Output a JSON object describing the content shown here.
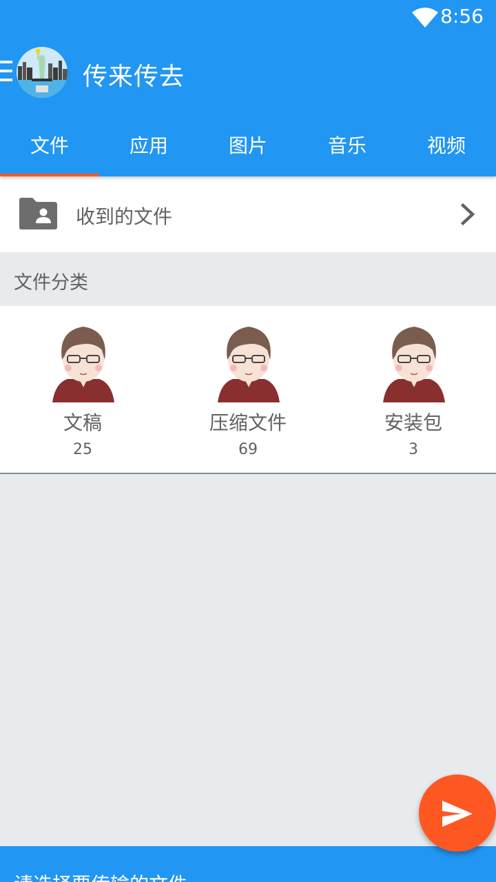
{
  "status_bar": {
    "time": "8:56"
  },
  "app_bar": {
    "title": "传来传去"
  },
  "tabs": [
    {
      "label": "文件",
      "active": true
    },
    {
      "label": "应用",
      "active": false
    },
    {
      "label": "图片",
      "active": false
    },
    {
      "label": "音乐",
      "active": false
    },
    {
      "label": "视频",
      "active": false
    }
  ],
  "received": {
    "label": "收到的文件",
    "icon": "folder-shared-icon"
  },
  "categories_section": {
    "title": "文件分类",
    "items": [
      {
        "label": "文稿",
        "count": "25"
      },
      {
        "label": "压缩文件",
        "count": "69"
      },
      {
        "label": "安装包",
        "count": "3"
      }
    ]
  },
  "bottom_bar": {
    "text": "请选择要传输的文件"
  },
  "colors": {
    "primary": "#2196f3",
    "accent": "#ff5722",
    "background": "#e8ebee",
    "text_secondary": "#616161"
  }
}
